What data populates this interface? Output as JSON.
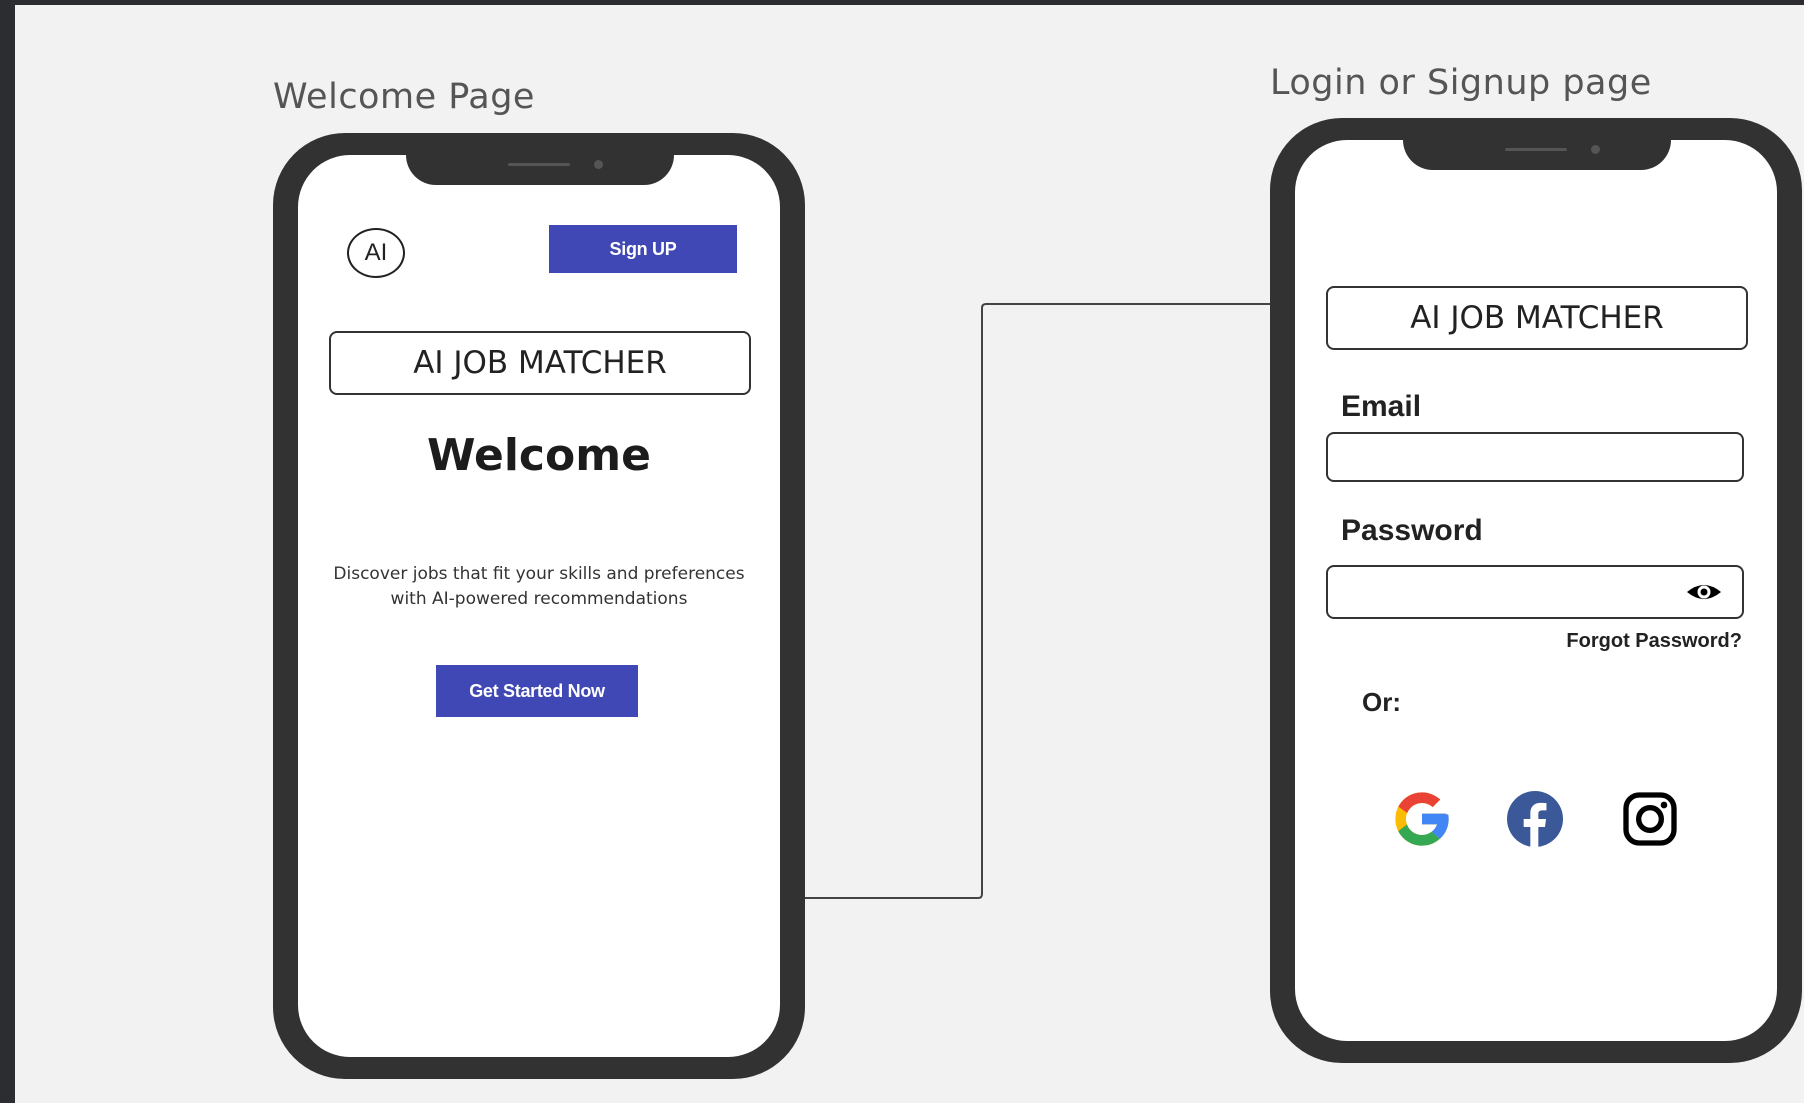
{
  "welcome_page": {
    "title": "Welcome Page",
    "logo_text": "AI",
    "signup_label": "Sign UP",
    "brand": "AI JOB MATCHER",
    "heading": "Welcome",
    "description_line1": "Discover jobs that fit your skills and preferences",
    "description_line2": "with AI-powered recommendations",
    "cta_label": "Get Started Now"
  },
  "login_page": {
    "title": "Login or Signup page",
    "brand": "AI JOB MATCHER",
    "email_label": "Email",
    "email_value": "",
    "password_label": "Password",
    "password_value": "",
    "forgot_label": "Forgot Password?",
    "or_label": "Or:",
    "social_icons": [
      "google-icon",
      "facebook-icon",
      "instagram-icon"
    ]
  },
  "colors": {
    "primary_button": "#3f48b4",
    "phone_frame": "#323232",
    "canvas_bg": "#f2f2f2",
    "google_blue": "#4285F4",
    "google_red": "#EA4335",
    "google_yellow": "#FBBC05",
    "google_green": "#34A853",
    "facebook_blue": "#3b5998"
  }
}
